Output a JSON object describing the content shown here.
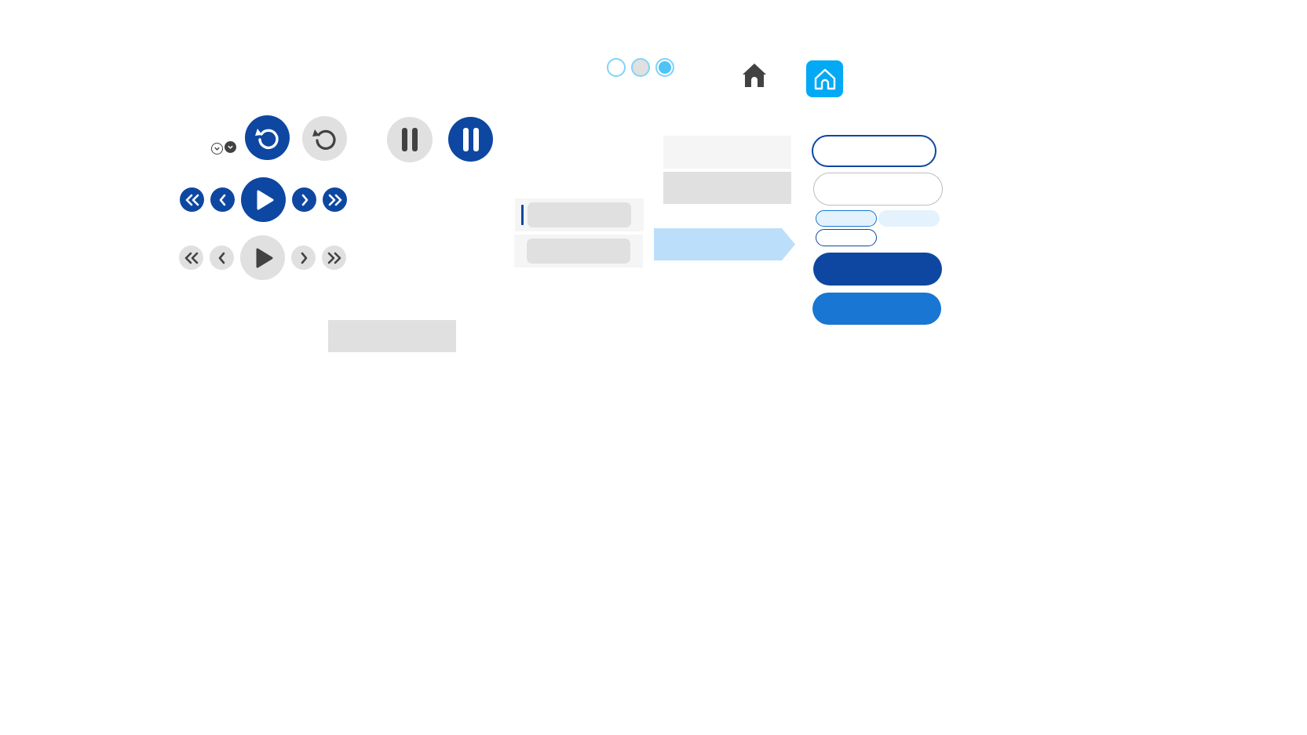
{
  "colors": {
    "primary_navy": "#0d47a1",
    "primary_blue": "#1976d2",
    "accent_cyan": "#03a9f4",
    "light_blue": "#bbdefb",
    "pale_blue": "#e3f2fd",
    "neutral_light": "#e0e0e0",
    "neutral_lighter": "#f5f5f5",
    "icon_dark": "#424242"
  },
  "icons": {
    "home_plain": "home-icon",
    "home_tile": "home-icon",
    "chevrons": "chevron-down-icon",
    "replay": "replay-icon",
    "pause": "pause-icon",
    "play": "play-icon",
    "first": "double-chevron-left-icon",
    "prev": "chevron-left-icon",
    "next": "chevron-right-icon",
    "last": "double-chevron-right-icon"
  },
  "pager_dots": [
    "empty",
    "neutral",
    "selected"
  ]
}
